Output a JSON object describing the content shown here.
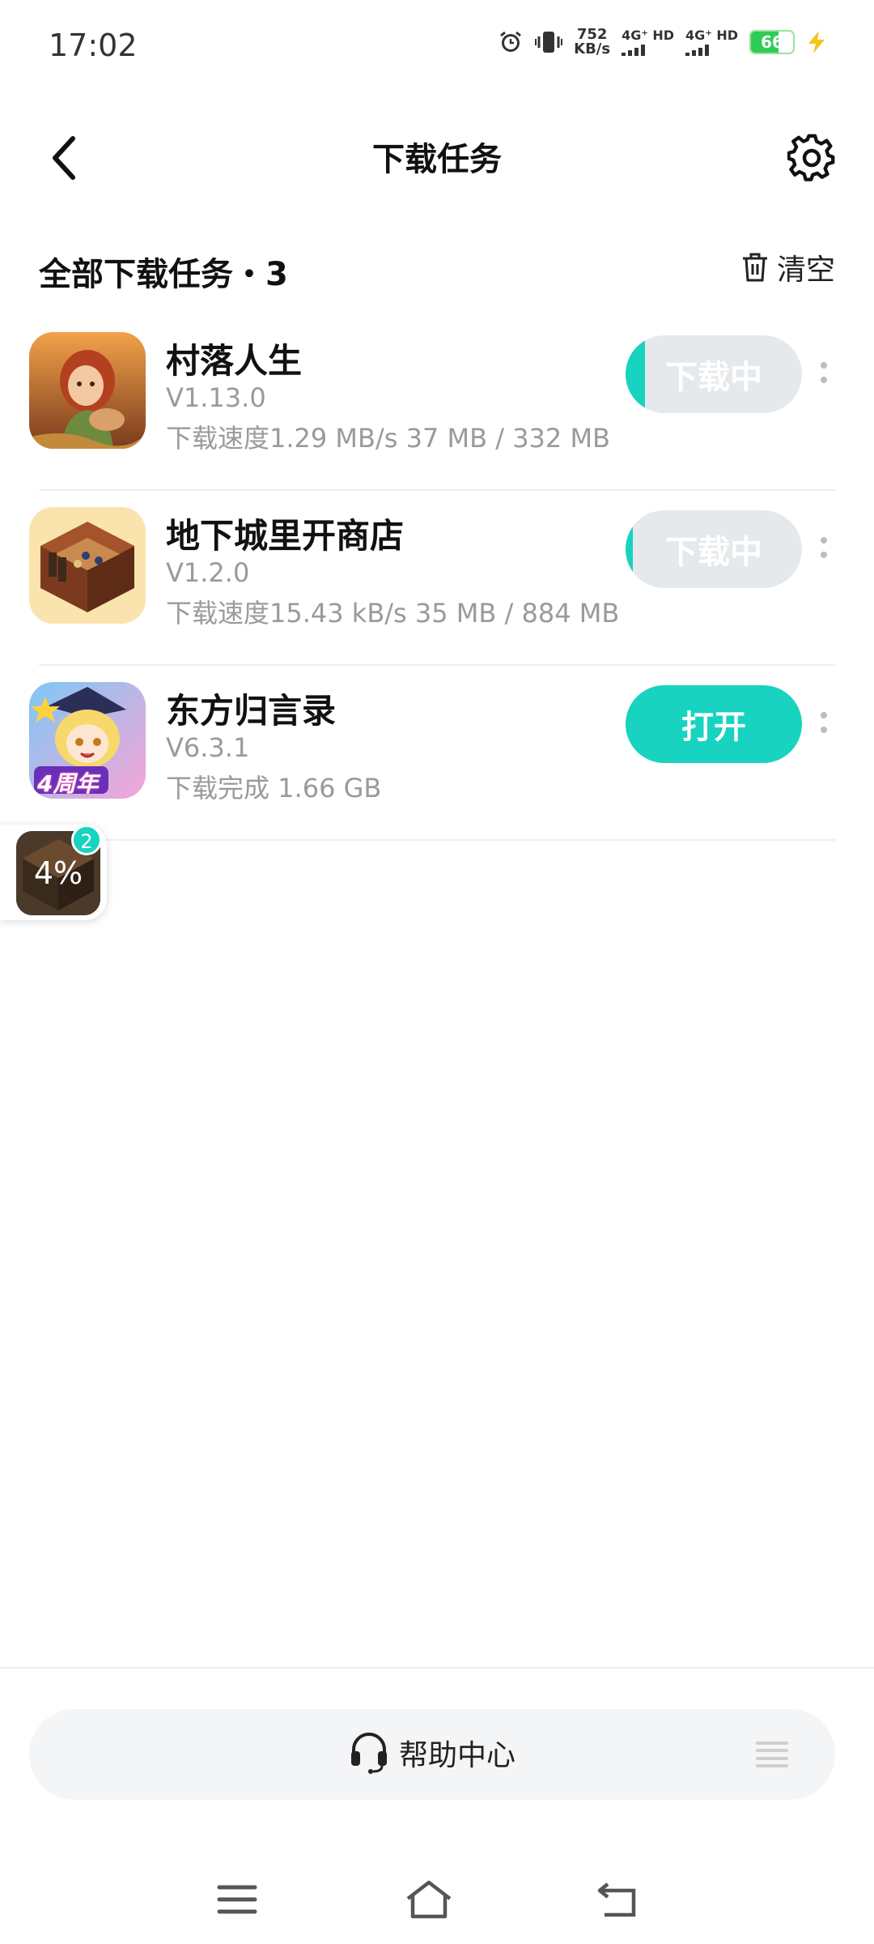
{
  "status_bar": {
    "time": "17:02",
    "net_speed_value": "752",
    "net_speed_unit": "KB/s",
    "sim1_label": "4G⁺ HD",
    "sim2_label": "4G⁺ HD",
    "battery_level": "66",
    "battery_fraction": 0.66,
    "icons": [
      "alarm-icon",
      "vibrate-icon",
      "signal-icon",
      "battery-icon",
      "charging-icon"
    ]
  },
  "header": {
    "title": "下载任务",
    "back_icon": "chevron-left-icon",
    "settings_icon": "gear-icon"
  },
  "section": {
    "title": "全部下载任务・3",
    "clear_label": "清空",
    "clear_icon": "trash-icon"
  },
  "tasks": [
    {
      "name": "村落人生",
      "version": "V1.13.0",
      "status": "下载速度1.29 MB/s   37 MB / 332 MB",
      "action_label": "下载中",
      "action_state": "downloading",
      "progress": 0.11
    },
    {
      "name": "地下城里开商店",
      "version": "V1.2.0",
      "status": "下载速度15.43 kB/s   35 MB / 884 MB",
      "action_label": "下载中",
      "action_state": "downloading",
      "progress": 0.04
    },
    {
      "name": "东方归言录",
      "version": "V6.3.1",
      "status": "下载完成   1.66 GB",
      "action_label": "打开",
      "action_state": "open",
      "icon_caption": "4周年"
    }
  ],
  "floating_badge": {
    "percent": "4%",
    "count": "2"
  },
  "footer": {
    "help_label": "帮助中心",
    "help_icon": "headset-icon",
    "menu_icon": "menu-icon"
  },
  "navbar": {
    "icons": [
      "menu-icon",
      "home-icon",
      "back-icon"
    ]
  },
  "colors": {
    "accent": "#17d3c0",
    "button_idle": "#e6e9ec",
    "secondary_text": "#9a9a9a"
  }
}
